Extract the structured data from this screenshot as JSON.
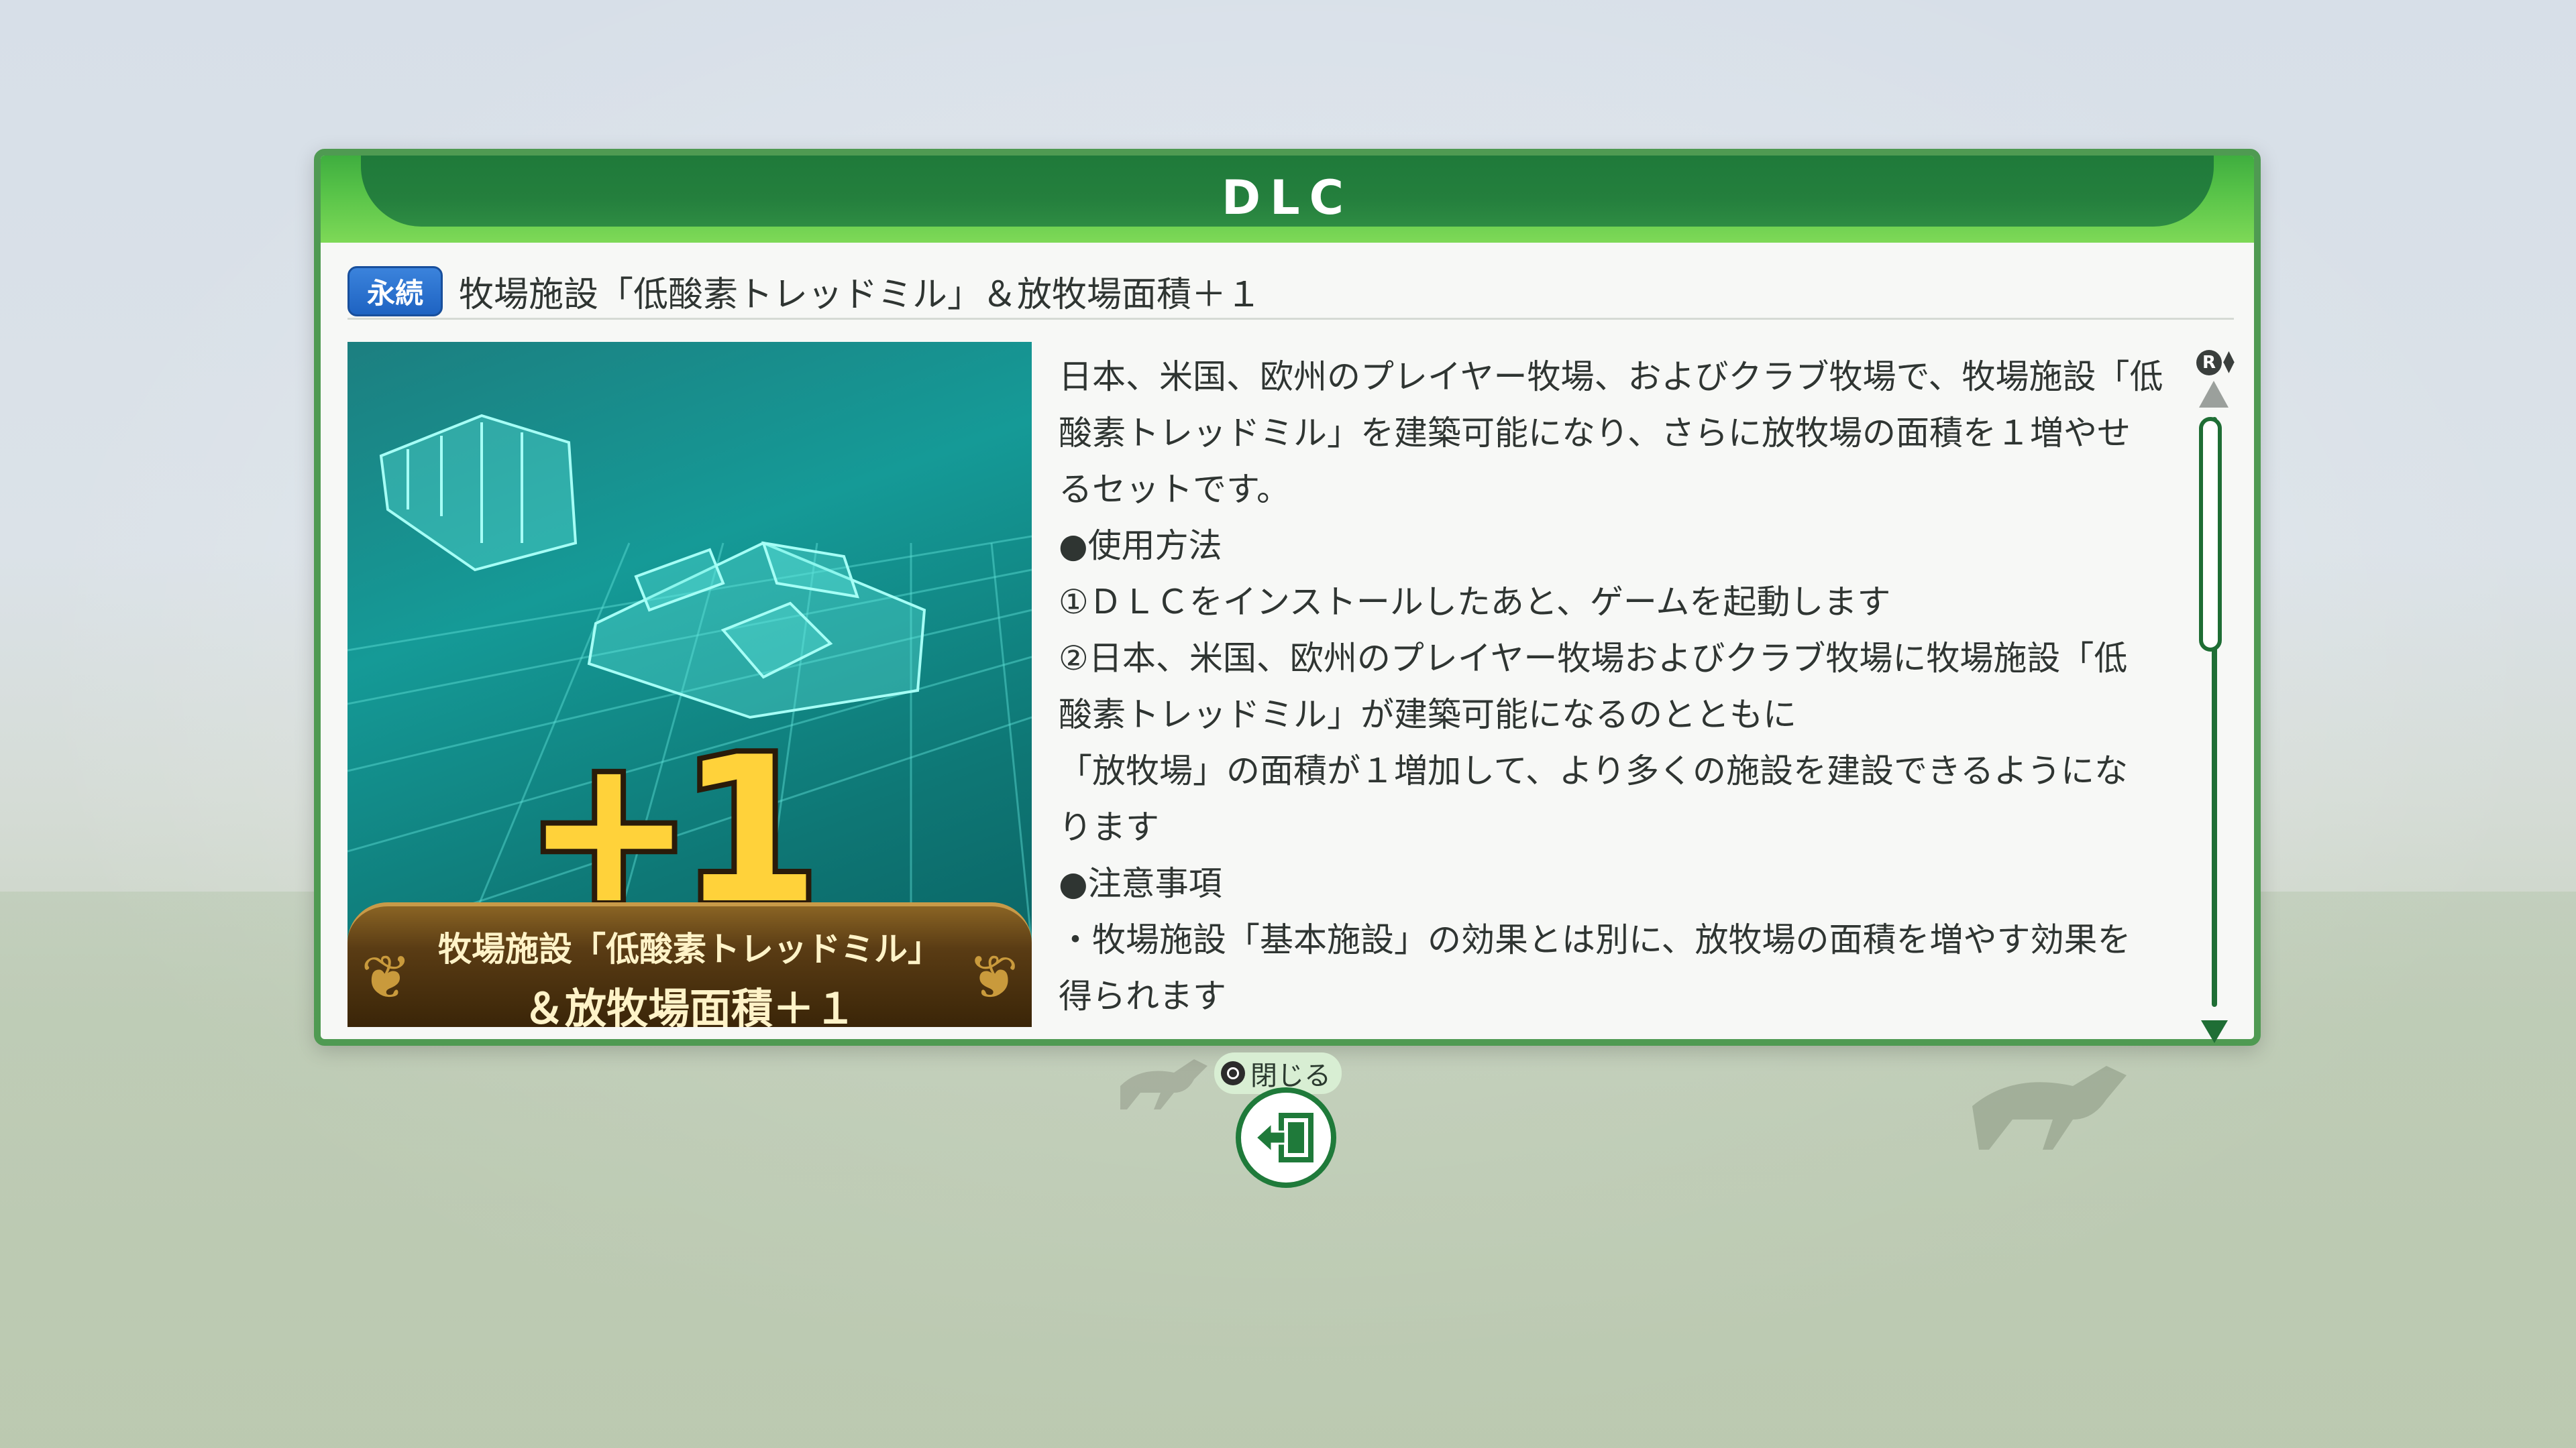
{
  "dialog": {
    "title": "DLC",
    "badge": "永続",
    "item_name": "牧場施設「低酸素トレッドミル」＆放牧場面積＋１"
  },
  "image": {
    "plus_label": "+1",
    "banner_line1": "牧場施設「低酸素トレッドミル」",
    "banner_line2": "＆放牧場面積＋１"
  },
  "description": {
    "lines": [
      "日本、米国、欧州のプレイヤー牧場、およびクラブ牧場で、牧場施設「低",
      "酸素トレッドミル」を建築可能になり、さらに放牧場の面積を１増やせ",
      "るセットです。",
      "●使用方法",
      "①ＤＬＣをインストールしたあと、ゲームを起動します",
      "②日本、米国、欧州のプレイヤー牧場およびクラブ牧場に牧場施設「低",
      "酸素トレッドミル」が建築可能になるのとともに",
      "「放牧場」の面積が１増加して、より多くの施設を建設できるようにな",
      "ります",
      "●注意事項",
      "・牧場施設「基本施設」の効果とは別に、放牧場の面積を増やす効果を",
      "得られます"
    ]
  },
  "scroll": {
    "button_label": "R",
    "position": 0.0
  },
  "close": {
    "label": "閉じる"
  },
  "colors": {
    "header_green": "#247f3d",
    "frame_green": "#4f9a52",
    "badge_blue": "#1e63c2",
    "plus_gold": "#ffd23a"
  }
}
